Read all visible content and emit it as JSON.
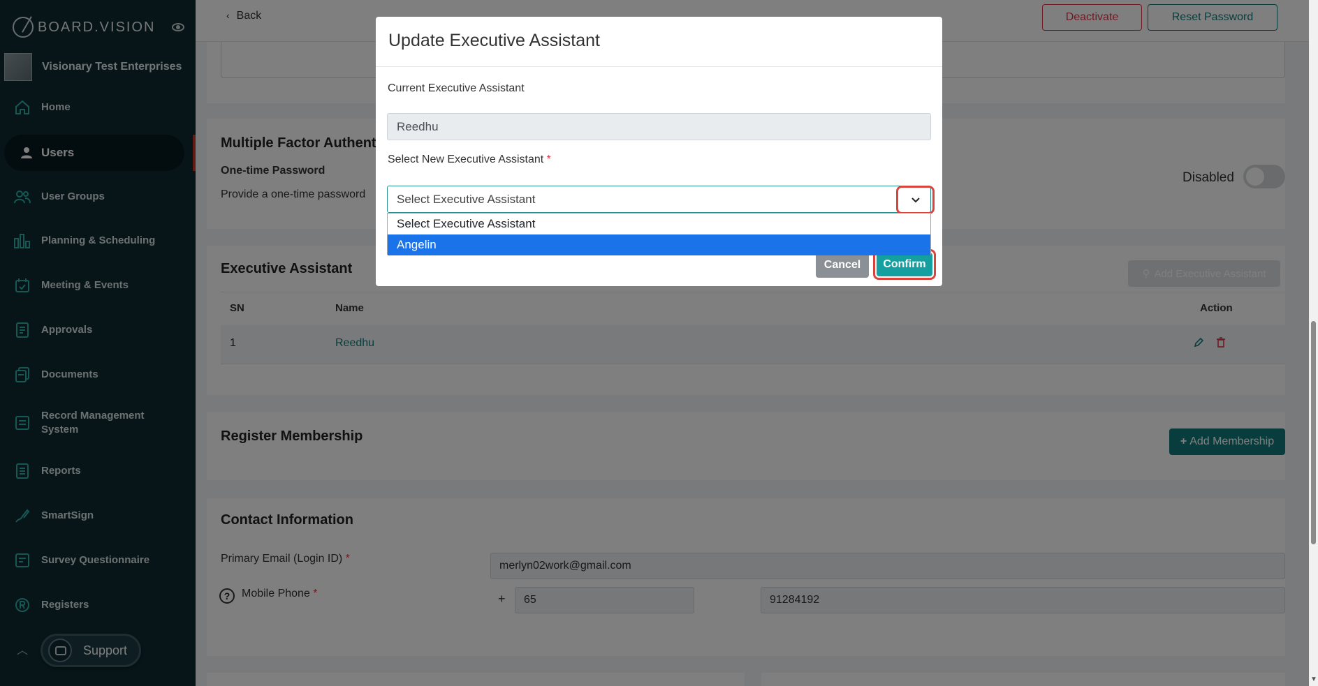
{
  "brand": {
    "name": "BOARD.VISION"
  },
  "org": {
    "name": "Visionary Test Enterprises"
  },
  "sidebar": {
    "items": [
      {
        "label": "Home"
      },
      {
        "label": "Users"
      },
      {
        "label": "User Groups"
      },
      {
        "label": "Planning & Scheduling"
      },
      {
        "label": "Meeting & Events"
      },
      {
        "label": "Approvals"
      },
      {
        "label": "Documents"
      },
      {
        "label": "Record Management System"
      },
      {
        "label": "Reports"
      },
      {
        "label": "SmartSign"
      },
      {
        "label": "Survey Questionnaire"
      },
      {
        "label": "Registers"
      }
    ],
    "support_label": "Support"
  },
  "topbar": {
    "back_label": "Back",
    "deactivate_label": "Deactivate",
    "reset_password_label": "Reset Password"
  },
  "mfa": {
    "title": "Multiple Factor Authentication",
    "otp_title": "One-time Password",
    "otp_desc": "Provide a one-time password",
    "status": "Disabled"
  },
  "ea_section": {
    "title": "Executive Assistant",
    "add_label": "Add Executive Assistant",
    "columns": [
      "SN",
      "Name",
      "Action"
    ],
    "rows": [
      {
        "sn": "1",
        "name": "Reedhu"
      }
    ]
  },
  "membership": {
    "title": "Register Membership",
    "add_label": "Add Membership"
  },
  "contact": {
    "title": "Contact Information",
    "email_label": "Primary Email (Login ID)",
    "email_value": "merlyn02work@gmail.com",
    "phone_label": "Mobile Phone",
    "country_code_prefix": "+",
    "country_code": "65",
    "phone_number": "91284192",
    "required_mark": "*"
  },
  "modal": {
    "title": "Update Executive Assistant",
    "current_label": "Current Executive Assistant",
    "current_value": "Reedhu",
    "select_label": "Select New Executive Assistant",
    "required_mark": "*",
    "select_value": "Select Executive Assistant",
    "options": [
      "Select Executive Assistant",
      "Angelin"
    ],
    "cancel_label": "Cancel",
    "confirm_label": "Confirm"
  },
  "colors": {
    "sidebar_bg": "#0e2b33",
    "accent_teal": "#127b7b",
    "danger": "#dc3545",
    "highlight_ring": "#d9453c",
    "option_selected": "#1a73e8"
  }
}
